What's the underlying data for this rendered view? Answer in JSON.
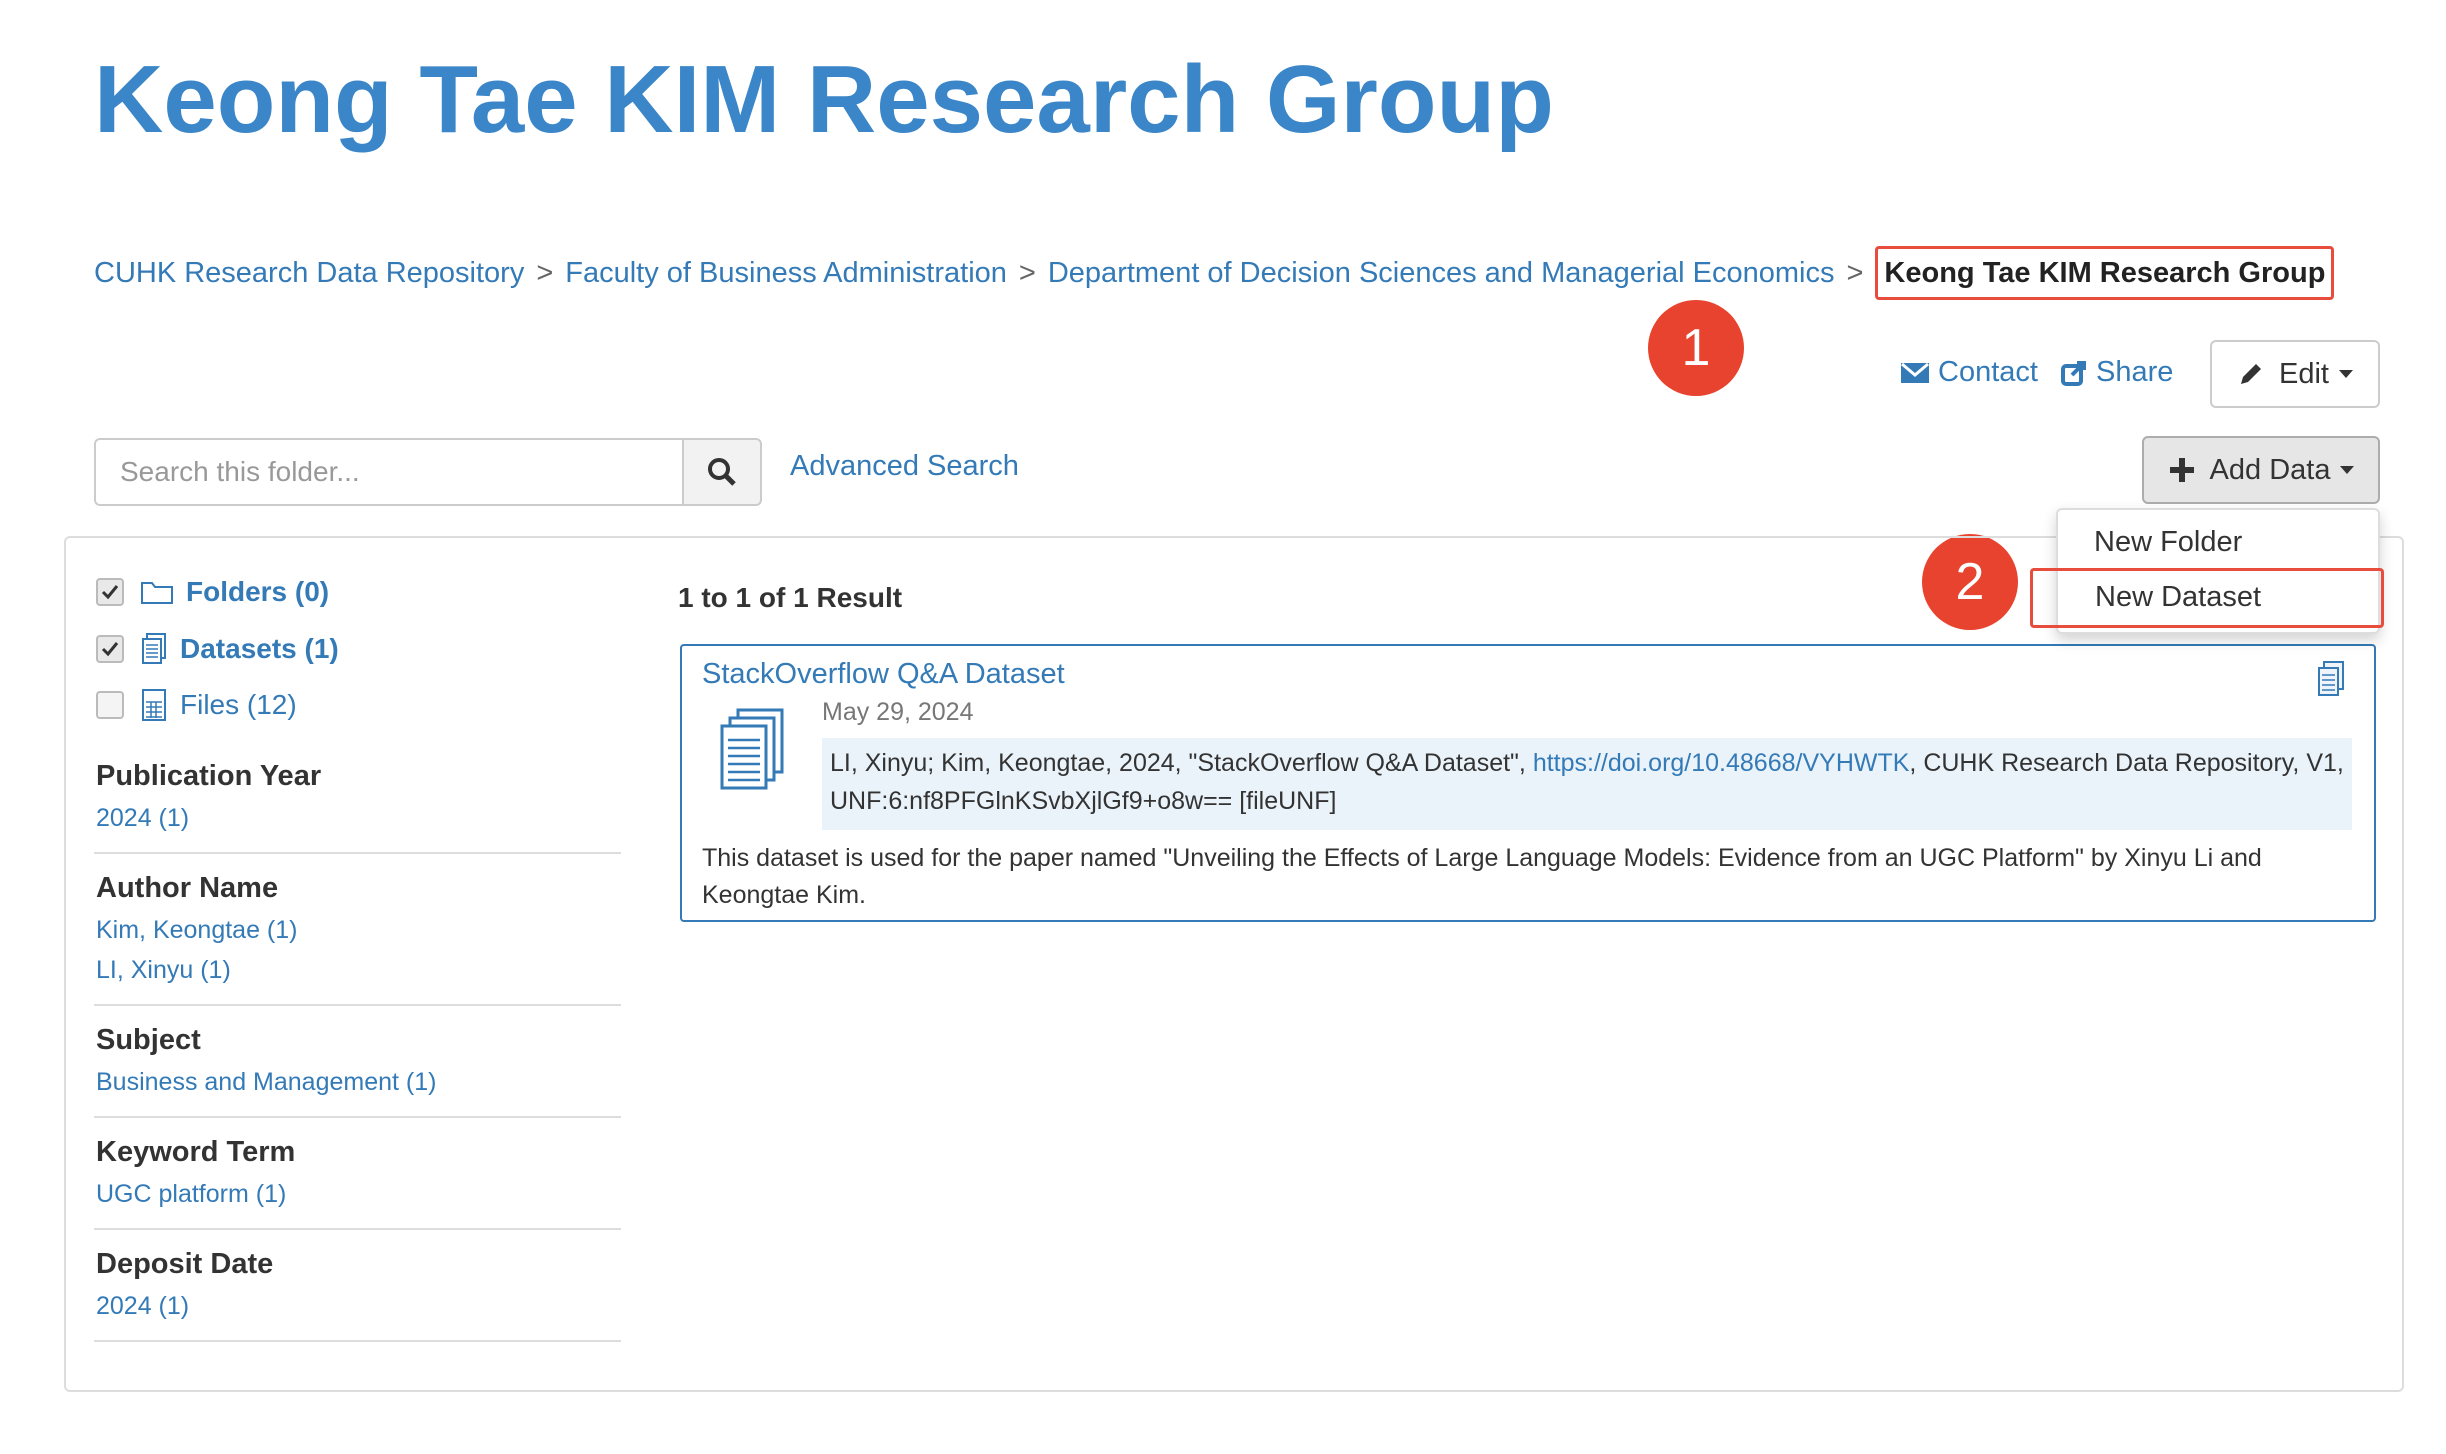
{
  "header": {
    "title": "Keong Tae KIM Research Group"
  },
  "breadcrumb": {
    "items": [
      "CUHK Research Data Repository",
      "Faculty of Business Administration",
      "Department of Decision Sciences and Managerial Economics"
    ],
    "separator": ">",
    "current": "Keong Tae KIM Research Group"
  },
  "markers": {
    "one": "1",
    "two": "2"
  },
  "actions": {
    "contact": "Contact",
    "share": "Share",
    "edit": "Edit",
    "add_data": "Add Data",
    "menu": [
      "New Folder",
      "New Dataset"
    ]
  },
  "search": {
    "placeholder": "Search this folder...",
    "advanced": "Advanced Search"
  },
  "facets": {
    "types": [
      {
        "label": "Folders (0)",
        "checked": true
      },
      {
        "label": "Datasets (1)",
        "checked": true
      },
      {
        "label": "Files (12)",
        "checked": false
      }
    ],
    "groups": [
      {
        "title": "Publication Year",
        "items": [
          "2024 (1)"
        ]
      },
      {
        "title": "Author Name",
        "items": [
          "Kim, Keongtae (1)",
          "LI, Xinyu (1)"
        ]
      },
      {
        "title": "Subject",
        "items": [
          "Business and Management (1)"
        ]
      },
      {
        "title": "Keyword Term",
        "items": [
          "UGC platform (1)"
        ]
      },
      {
        "title": "Deposit Date",
        "items": [
          "2024 (1)"
        ]
      }
    ]
  },
  "results": {
    "count_text": "1 to 1 of 1 Result",
    "item": {
      "title": "StackOverflow Q&A Dataset",
      "date": "May 29, 2024",
      "citation_pre": "LI, Xinyu; Kim, Keongtae, 2024, \"StackOverflow Q&A Dataset\", ",
      "citation_link": "https://doi.org/10.48668/VYHWTK",
      "citation_post": ", CUHK Research Data Repository, V1, UNF:6:nf8PFGlnKSvbXjlGf9+o8w== [fileUNF]",
      "description": "This dataset is used for the paper named \"Unveiling the Effects of Large Language Models: Evidence from an UGC Platform\" by Xinyu Li and Keongtae Kim."
    }
  },
  "colors": {
    "title": "#3b86c8",
    "link": "#337ab7",
    "highlight": "#e74c3c",
    "marker": "#e8432e"
  }
}
